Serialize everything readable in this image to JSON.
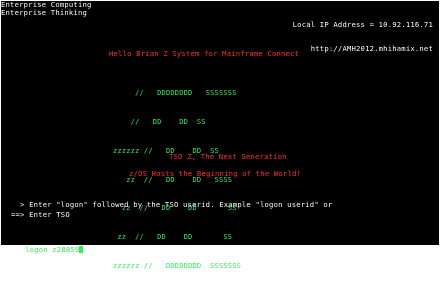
{
  "header": {
    "left_line1": "Enterprise Computing",
    "left_line2": "Enterprise Thinking",
    "right_line1": "Local IP Address = 10.92.116.71",
    "right_line2": "http://AMH2012.mhihamix.net"
  },
  "banner_title": "Hello Brian Z System for Mainframe Connect",
  "logo_lines": [
    "     //   DDDDDDDD   SSSSSSS",
    "    //   DD    DD  SS",
    "zzzzzz //   DD    DD  SS",
    "   zz  //   DD    DD   SSSS",
    "  zz  //   DD    DD       SS",
    " zz  //   DD    DD       SS",
    "zzzzzz //   DDDDDDDD  SSSSSSS"
  ],
  "tagline1": "TSO Z, The Next Generation",
  "tagline2": "z/OS Hosts the Beginning of the World!",
  "instructions": {
    "line1": "  > Enter \"logon\" followed by the TSO userid. Example \"logon userid\" or",
    "line2": "==> Enter TSO"
  },
  "status_line": "logon z28859"
}
